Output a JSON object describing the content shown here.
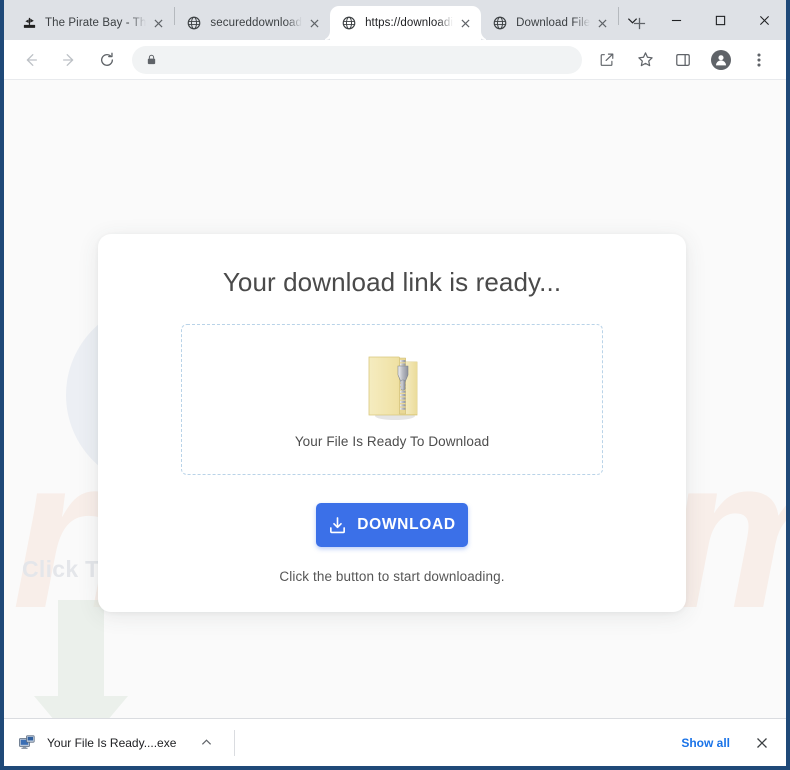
{
  "browser": {
    "tabs": [
      {
        "title": "The Pirate Bay - Th",
        "favicon": "pirate-ship-icon",
        "active": false
      },
      {
        "title": "secureddownload",
        "favicon": "globe-icon",
        "active": false
      },
      {
        "title": "https://downloadi",
        "favicon": "globe-icon",
        "active": true
      },
      {
        "title": "Download File",
        "favicon": "globe-icon",
        "active": false
      }
    ],
    "new_tab_label": "+",
    "window_controls": {
      "tab_search": "tab-search-chevron",
      "minimize": "minimize",
      "maximize": "maximize",
      "close": "close"
    },
    "toolbar": {
      "back": "back-arrow",
      "forward": "forward-arrow",
      "reload": "reload",
      "omnibox_value": "",
      "omnibox_placeholder": "",
      "lock_icon": "lock-icon",
      "share": "share-icon",
      "bookmark": "star-icon",
      "side_panel": "side-panel-icon",
      "profile": "profile-avatar",
      "menu": "three-dot-menu"
    }
  },
  "page": {
    "card": {
      "title": "Your download link is ready...",
      "dropzone_text": "Your File Is Ready To Download",
      "file_icon": "zip-folder-icon",
      "download_button": {
        "label": "DOWNLOAD",
        "icon": "download-tray-icon",
        "color": "#3b70e8"
      },
      "hint": "Click the button to start downloading."
    },
    "background": {
      "click_to_view_text": "Click To View",
      "arrow_icon": "down-arrow-icon",
      "watermark_primary": "PC",
      "watermark_secondary": "risk.com",
      "watermark_primary_color": "#78828f",
      "watermark_secondary_color": "#e8783c",
      "page_background_color": "#fafafa"
    }
  },
  "download_shelf": {
    "file_name": "Your File Is Ready....exe",
    "file_icon": "exe-file-icon",
    "caret": "chevron-up-icon",
    "show_all_label": "Show all",
    "close_label": "close",
    "accent_color": "#1a73e8"
  }
}
